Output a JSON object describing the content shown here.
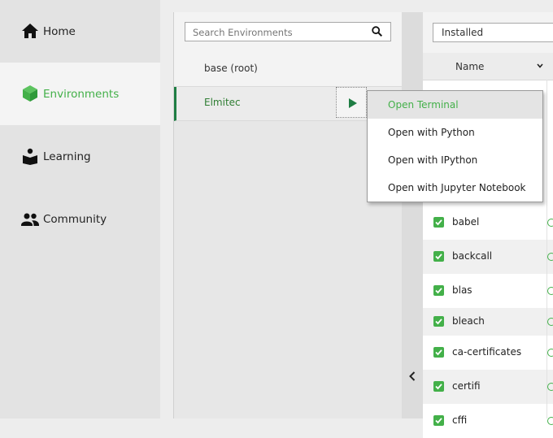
{
  "nav": {
    "items": [
      {
        "label": "Home",
        "icon": "home-icon"
      },
      {
        "label": "Environments",
        "icon": "cube-icon",
        "active": true
      },
      {
        "label": "Learning",
        "icon": "book-reader-icon"
      },
      {
        "label": "Community",
        "icon": "people-icon"
      }
    ]
  },
  "environments": {
    "search_placeholder": "Search Environments",
    "items": [
      {
        "name": "base (root)"
      },
      {
        "name": "Elmitec",
        "selected": true
      }
    ]
  },
  "context_menu": {
    "items": [
      "Open Terminal",
      "Open with Python",
      "Open with IPython",
      "Open with Jupyter Notebook"
    ]
  },
  "packages": {
    "filter_value": "Installed",
    "column_name": "Name",
    "rows": [
      "babel",
      "backcall",
      "blas",
      "bleach",
      "ca-certificates",
      "certifi",
      "cffi"
    ]
  },
  "colors": {
    "accent": "#43b049",
    "selected_env": "#1e7d43"
  }
}
